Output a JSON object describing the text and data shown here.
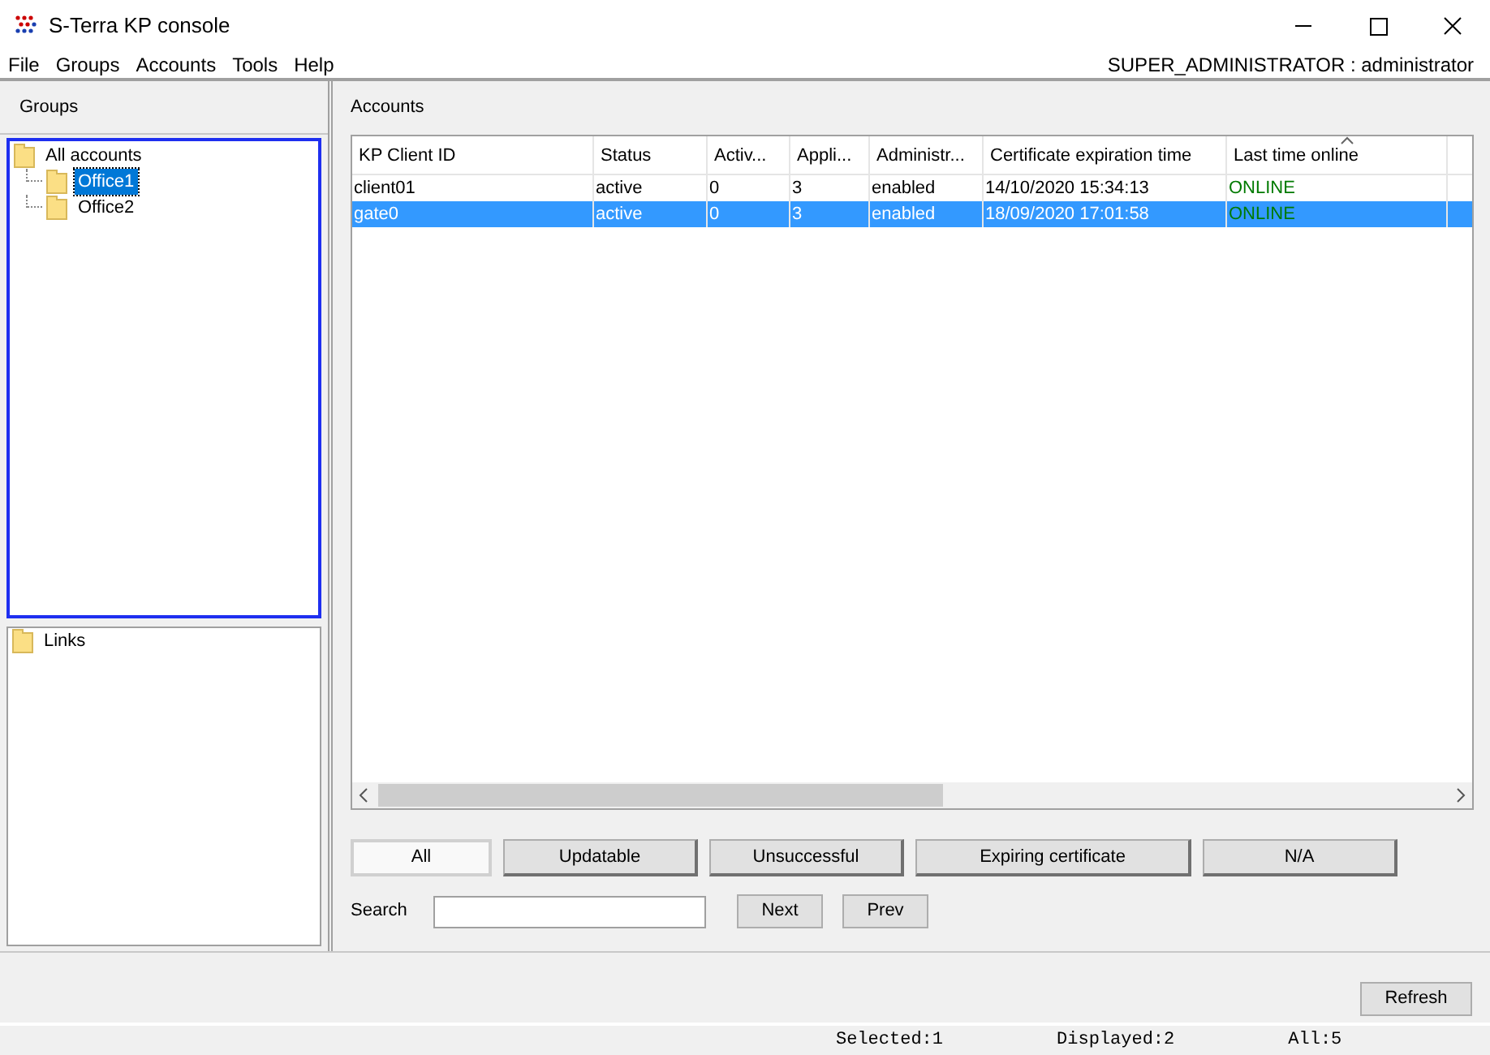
{
  "window": {
    "title": "S-Terra KP console"
  },
  "menu": [
    "File",
    "Groups",
    "Accounts",
    "Tools",
    "Help"
  ],
  "user": "SUPER_ADMINISTRATOR : administrator",
  "groups": {
    "title": "Groups",
    "tree": [
      {
        "label": "All accounts",
        "selected": false,
        "children": [
          {
            "label": "Office1",
            "selected": true
          },
          {
            "label": "Office2",
            "selected": false
          }
        ]
      }
    ]
  },
  "links": {
    "tree": [
      {
        "label": "Links",
        "selected": false
      }
    ]
  },
  "accounts": {
    "title": "Accounts",
    "columns": [
      {
        "label": "KP Client ID",
        "kind": "text",
        "sorted": false
      },
      {
        "label": "Status",
        "kind": "text",
        "sorted": false
      },
      {
        "label": "Activ...",
        "kind": "text",
        "sorted": false
      },
      {
        "label": "Appli...",
        "kind": "text",
        "sorted": false
      },
      {
        "label": "Administr...",
        "kind": "text",
        "sorted": false
      },
      {
        "label": "Certificate expiration time",
        "kind": "text",
        "sorted": false
      },
      {
        "label": "Last time online",
        "kind": "online",
        "sorted": true
      }
    ],
    "rows": [
      {
        "selected": false,
        "cells": [
          "client01",
          "active",
          "0",
          "3",
          "enabled",
          "14/10/2020 15:34:13",
          "ONLINE"
        ]
      },
      {
        "selected": true,
        "cells": [
          "gate0",
          "active",
          "0",
          "3",
          "enabled",
          "18/09/2020 17:01:58",
          "ONLINE"
        ]
      }
    ]
  },
  "filters": [
    {
      "label": "All",
      "selected": true
    },
    {
      "label": "Updatable",
      "selected": false
    },
    {
      "label": "Unsuccessful",
      "selected": false
    },
    {
      "label": "Expiring certificate",
      "selected": false
    },
    {
      "label": "N/A",
      "selected": false
    }
  ],
  "search": {
    "label": "Search"
  },
  "search_buttons": [
    "Next",
    "Prev"
  ],
  "refresh_button": "Refresh",
  "status_bar": [
    "Selected:1",
    "Displayed:2",
    "All:5"
  ]
}
